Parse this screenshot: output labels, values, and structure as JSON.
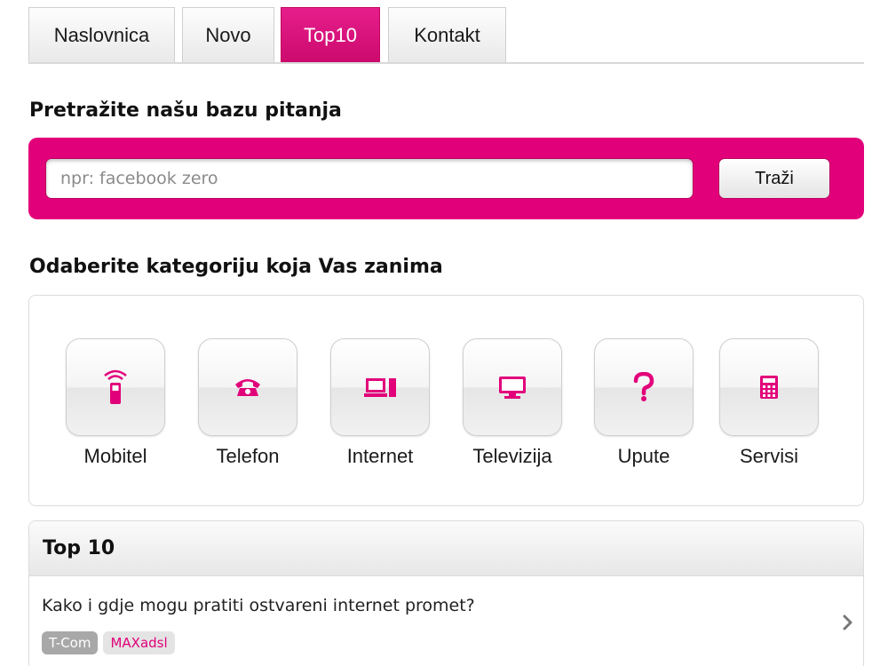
{
  "tabs": [
    {
      "label": "Naslovnica"
    },
    {
      "label": "Novo"
    },
    {
      "label": "Top10",
      "active": true
    },
    {
      "label": "Kontakt"
    }
  ],
  "search": {
    "heading": "Pretražite našu bazu pitanja",
    "placeholder": "npr: facebook zero",
    "value": "",
    "button_label": "Traži"
  },
  "categories": {
    "heading": "Odaberite kategoriju koja Vas zanima",
    "items": [
      {
        "label": "Mobitel",
        "icon": "mobile-phone-icon"
      },
      {
        "label": "Telefon",
        "icon": "telephone-icon"
      },
      {
        "label": "Internet",
        "icon": "computer-icon"
      },
      {
        "label": "Televizija",
        "icon": "tv-icon"
      },
      {
        "label": "Upute",
        "icon": "question-mark-icon"
      },
      {
        "label": "Servisi",
        "icon": "calculator-icon"
      }
    ]
  },
  "top10": {
    "title": "Top 10",
    "items": [
      {
        "question": "Kako i gdje mogu pratiti ostvareni internet promet?",
        "tags": [
          "T-Com",
          "MAXadsl"
        ]
      }
    ]
  },
  "colors": {
    "accent": "#e2007a",
    "tab_active": "#d6107a",
    "tag_brand_bg": "#a8a8a8",
    "tag_product_bg": "#e4e4e4"
  }
}
